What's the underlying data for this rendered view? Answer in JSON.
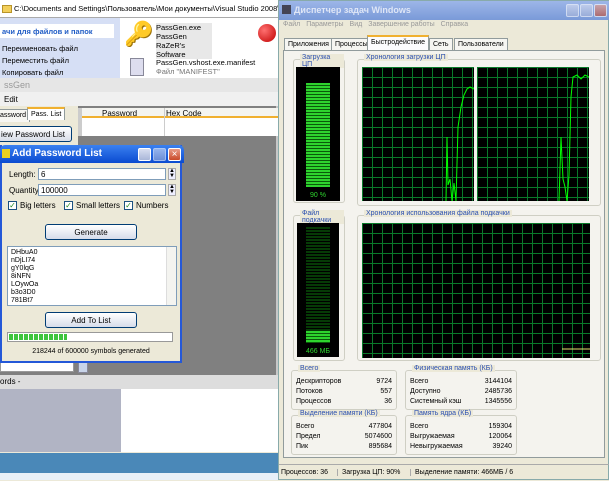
{
  "explorer": {
    "address": "C:\\Documents and Settings\\Пользователь\\Мои документы\\Visual Studio 2008\\Projects",
    "tasks_header": "ачи для файлов и папок",
    "tasks": [
      "Переименовать файл",
      "Переместить файл",
      "Копировать файл"
    ],
    "files": [
      {
        "name": "PassGen.exe",
        "line2": "PassGen",
        "line3": "RaZeR's Software",
        "icon": "key-icon"
      },
      {
        "name": "PassGen.vshost.exe.manifest",
        "line2": "Файл \"MANIFEST\"",
        "icon": "manifest-icon"
      }
    ]
  },
  "passgen": {
    "title": "ssGen",
    "menu": [
      "Edit"
    ],
    "tabs": [
      "assword",
      "Pass. List"
    ],
    "view_button": "iew Password List",
    "columns": [
      "Password",
      "Hex Code"
    ],
    "status": "ords  -"
  },
  "dialog": {
    "title": "Add Password List",
    "length_label": "Length:",
    "length_value": "6",
    "quantity_label": "Quantity:",
    "quantity_value": "100000",
    "checks": [
      {
        "label": "Big letters",
        "checked": true
      },
      {
        "label": "Small letters",
        "checked": true
      },
      {
        "label": "Numbers",
        "checked": true
      }
    ],
    "generate": "Generate",
    "passwords": [
      "DHbuA0",
      "nDjLI74",
      "gY0lqG",
      "8iNFN",
      "LOywOa",
      "b3o3D0",
      "781Bt7"
    ],
    "add_to_list": "Add To List",
    "progress": 0.36,
    "progress_text": "218244 of 600000 symbols generated"
  },
  "taskmgr": {
    "title": "Диспетчер задач Windows",
    "menu": [
      "Файл",
      "Параметры",
      "Вид",
      "Завершение работы",
      "Справка"
    ],
    "tabs": [
      "Приложения",
      "Процессы",
      "Быстродействие",
      "Сеть",
      "Пользователи"
    ],
    "active_tab": 2,
    "cpu_label": "Загрузка ЦП",
    "cpu_value": "90 %",
    "cpu_fraction": 0.9,
    "cpu_history_label": "Хронология загрузки ЦП",
    "pf_label": "Файл подкачки",
    "pf_value": "466 МБ",
    "pf_fraction": 0.1,
    "pf_history_label": "Хронология использования файла подкачки",
    "totals": {
      "title": "Всего",
      "rows": [
        [
          "Дескрипторов",
          "9724"
        ],
        [
          "Потоков",
          "557"
        ],
        [
          "Процессов",
          "36"
        ]
      ]
    },
    "physical": {
      "title": "Физическая память (КБ)",
      "rows": [
        [
          "Всего",
          "3144104"
        ],
        [
          "Доступно",
          "2485736"
        ],
        [
          "Системный кэш",
          "1345556"
        ]
      ]
    },
    "commit": {
      "title": "Выделение памяти (КБ)",
      "rows": [
        [
          "Всего",
          "477804"
        ],
        [
          "Предел",
          "5074600"
        ],
        [
          "Пик",
          "895684"
        ]
      ]
    },
    "kernel": {
      "title": "Память ядра (КБ)",
      "rows": [
        [
          "Всего",
          "159304"
        ],
        [
          "Выгружаемая",
          "120064"
        ],
        [
          "Невыгружаемая",
          "39240"
        ]
      ]
    },
    "status": [
      "Процессов: 36",
      "Загрузка ЦП: 90%",
      "Выделение памяти: 466МБ / 6"
    ],
    "colors": {
      "graph": "#00ff00",
      "grid": "#0a7a2a"
    }
  }
}
